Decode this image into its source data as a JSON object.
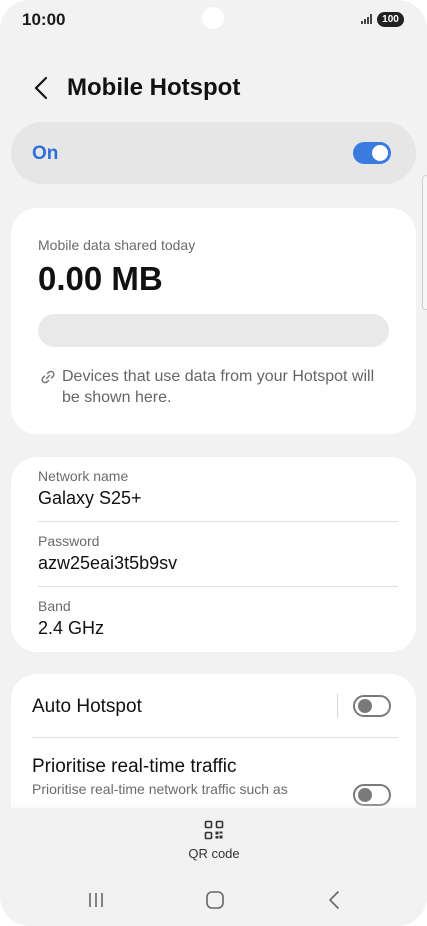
{
  "status_bar": {
    "time": "10:00",
    "battery": "100"
  },
  "header": {
    "title": "Mobile Hotspot"
  },
  "master_switch": {
    "label": "On",
    "state": "on"
  },
  "usage_card": {
    "label": "Mobile data shared today",
    "value": "0.00 MB",
    "note": "Devices that use data from your Hotspot will be shown here."
  },
  "network_card": {
    "fields": [
      {
        "label": "Network name",
        "value": "Galaxy S25+"
      },
      {
        "label": "Password",
        "value": "azw25eai3t5b9sv"
      },
      {
        "label": "Band",
        "value": "2.4 GHz"
      }
    ]
  },
  "options_card": {
    "auto_hotspot": {
      "label": "Auto Hotspot",
      "state": "off"
    },
    "prioritise": {
      "label": "Prioritise real-time traffic",
      "description": "Prioritise real-time network traffic such as",
      "state": "off"
    }
  },
  "bottom": {
    "qr_label": "QR code"
  },
  "colors": {
    "accent": "#3a7be0",
    "background": "#f2f2f2",
    "card": "#ffffff"
  }
}
